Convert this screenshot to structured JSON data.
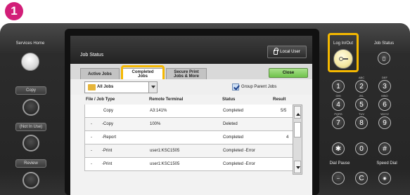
{
  "step_badge": "1",
  "left_panel": {
    "services_home": "Services Home",
    "copy": "Copy",
    "not_in_use": "(Not In Use)",
    "review": "Review"
  },
  "screen": {
    "title": "Job Status",
    "local_user": "Local User",
    "tabs": [
      {
        "label": "Active Jobs"
      },
      {
        "label_line1": "Completed",
        "label_line2": "Jobs"
      },
      {
        "label_line1": "Secure Print",
        "label_line2": "Jobs & More"
      }
    ],
    "close": "Close",
    "filter": {
      "selected": "All Jobs",
      "group_parent": "Group Parent Jobs"
    },
    "columns": [
      "File / Job Type",
      "Remote Terminal",
      "Status",
      "Result"
    ],
    "rows": [
      {
        "indent": "",
        "type": "Copy",
        "remote": "A3:141%",
        "status": "Completed",
        "result": "5/5"
      },
      {
        "indent": "-",
        "type": "-Copy",
        "remote": "100%",
        "status": "Deleted",
        "result": ""
      },
      {
        "indent": "-",
        "type": "-Report",
        "remote": "",
        "status": "Completed",
        "result": "4"
      },
      {
        "indent": "-",
        "type": "-Print",
        "remote": "user1:KSC1505",
        "status": "Completed -Error",
        "result": ""
      },
      {
        "indent": "-",
        "type": "-Print",
        "remote": "user1:KSC1505",
        "status": "Completed -Error",
        "result": ""
      }
    ]
  },
  "right_panel": {
    "login_out": "Log In/Out",
    "job_status": "Job Status",
    "keys": [
      {
        "digit": "1",
        "cap": ""
      },
      {
        "digit": "2",
        "cap": "ABC"
      },
      {
        "digit": "3",
        "cap": "DEF"
      },
      {
        "digit": "4",
        "cap": "GHI"
      },
      {
        "digit": "5",
        "cap": "JKL"
      },
      {
        "digit": "6",
        "cap": "MNO"
      },
      {
        "digit": "7",
        "cap": "PQRS"
      },
      {
        "digit": "8",
        "cap": "TUV"
      },
      {
        "digit": "9",
        "cap": "WXYZ"
      },
      {
        "digit": "✱",
        "cap": ""
      },
      {
        "digit": "0",
        "cap": ""
      },
      {
        "digit": "#",
        "cap": ""
      }
    ],
    "dial_pause": "Dial Pause",
    "speed_dial": "Speed Dial",
    "clear_key": "C"
  },
  "colors": {
    "highlight": "#f5b800",
    "close_button": "#7cc85a",
    "badge": "#d21e78"
  }
}
